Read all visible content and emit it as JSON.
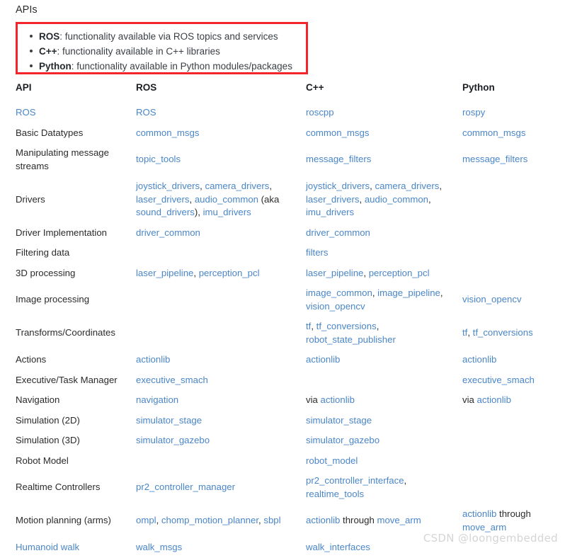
{
  "heading": "APIs",
  "callout": {
    "accent_color": "#f4252a",
    "items": [
      {
        "term": "ROS",
        "rest": ": functionality available via ROS topics and services"
      },
      {
        "term": "C++",
        "rest": ": functionality available in C++ libraries"
      },
      {
        "term": "Python",
        "rest": ": functionality available in Python modules/packages"
      }
    ]
  },
  "table": {
    "link_color": "#4a86c8",
    "columns": [
      "API",
      "ROS",
      "C++",
      "Python"
    ],
    "rows": [
      {
        "api": "ROS",
        "api_link": true,
        "ros": [
          {
            "t": "ROS",
            "link": true
          }
        ],
        "cpp": [
          {
            "t": "roscpp",
            "link": true
          }
        ],
        "py": [
          {
            "t": "rospy",
            "link": true
          }
        ]
      },
      {
        "api": "Basic Datatypes",
        "api_link": false,
        "ros": [
          {
            "t": "common_msgs",
            "link": true
          }
        ],
        "cpp": [
          {
            "t": "common_msgs",
            "link": true
          }
        ],
        "py": [
          {
            "t": "common_msgs",
            "link": true
          }
        ]
      },
      {
        "api": "Manipulating message streams",
        "api_link": false,
        "ros": [
          {
            "t": "topic_tools",
            "link": true
          }
        ],
        "cpp": [
          {
            "t": "message_filters",
            "link": true
          }
        ],
        "py": [
          {
            "t": "message_filters",
            "link": true
          }
        ]
      },
      {
        "api": "Drivers",
        "api_link": false,
        "ros": [
          {
            "t": "joystick_drivers",
            "link": true
          },
          {
            "t": ", ",
            "link": false
          },
          {
            "t": "camera_drivers",
            "link": true
          },
          {
            "t": ", ",
            "link": false
          },
          {
            "t": "laser_drivers",
            "link": true
          },
          {
            "t": ", ",
            "link": false
          },
          {
            "t": "audio_common",
            "link": true
          },
          {
            "t": " (aka ",
            "link": false
          },
          {
            "t": "sound_drivers",
            "link": true
          },
          {
            "t": "), ",
            "link": false
          },
          {
            "t": "imu_drivers",
            "link": true
          }
        ],
        "cpp": [
          {
            "t": "joystick_drivers",
            "link": true
          },
          {
            "t": ", ",
            "link": false
          },
          {
            "t": "camera_drivers",
            "link": true
          },
          {
            "t": ", ",
            "link": false
          },
          {
            "t": "laser_drivers",
            "link": true
          },
          {
            "t": ", ",
            "link": false
          },
          {
            "t": "audio_common",
            "link": true
          },
          {
            "t": ", ",
            "link": false
          },
          {
            "t": "imu_drivers",
            "link": true
          }
        ],
        "py": []
      },
      {
        "api": "Driver Implementation",
        "api_link": false,
        "ros": [
          {
            "t": "driver_common",
            "link": true
          }
        ],
        "cpp": [
          {
            "t": "driver_common",
            "link": true
          }
        ],
        "py": []
      },
      {
        "api": "Filtering data",
        "api_link": false,
        "ros": [],
        "cpp": [
          {
            "t": "filters",
            "link": true
          }
        ],
        "py": []
      },
      {
        "api": "3D processing",
        "api_link": false,
        "ros": [
          {
            "t": "laser_pipeline",
            "link": true
          },
          {
            "t": ", ",
            "link": false
          },
          {
            "t": "perception_pcl",
            "link": true
          }
        ],
        "cpp": [
          {
            "t": "laser_pipeline",
            "link": true
          },
          {
            "t": ", ",
            "link": false
          },
          {
            "t": "perception_pcl",
            "link": true
          }
        ],
        "py": []
      },
      {
        "api": "Image processing",
        "api_link": false,
        "ros": [],
        "cpp": [
          {
            "t": "image_common",
            "link": true
          },
          {
            "t": ", ",
            "link": false
          },
          {
            "t": "image_pipeline",
            "link": true
          },
          {
            "t": ", ",
            "link": false
          },
          {
            "t": "vision_opencv",
            "link": true
          }
        ],
        "py": [
          {
            "t": "vision_opencv",
            "link": true
          }
        ]
      },
      {
        "api": "Transforms/Coordinates",
        "api_link": false,
        "ros": [],
        "cpp": [
          {
            "t": "tf",
            "link": true
          },
          {
            "t": ", ",
            "link": false
          },
          {
            "t": "tf_conversions",
            "link": true
          },
          {
            "t": ", ",
            "link": false
          },
          {
            "t": "robot_state_publisher",
            "link": true
          }
        ],
        "py": [
          {
            "t": "tf",
            "link": true
          },
          {
            "t": ", ",
            "link": false
          },
          {
            "t": "tf_conversions",
            "link": true
          }
        ]
      },
      {
        "api": "Actions",
        "api_link": false,
        "ros": [
          {
            "t": "actionlib",
            "link": true
          }
        ],
        "cpp": [
          {
            "t": "actionlib",
            "link": true
          }
        ],
        "py": [
          {
            "t": "actionlib",
            "link": true
          }
        ]
      },
      {
        "api": "Executive/Task Manager",
        "api_link": false,
        "ros": [
          {
            "t": "executive_smach",
            "link": true
          }
        ],
        "cpp": [],
        "py": [
          {
            "t": "executive_smach",
            "link": true
          }
        ]
      },
      {
        "api": "Navigation",
        "api_link": false,
        "ros": [
          {
            "t": "navigation",
            "link": true
          }
        ],
        "cpp": [
          {
            "t": "via ",
            "link": false
          },
          {
            "t": "actionlib",
            "link": true
          }
        ],
        "py": [
          {
            "t": "via ",
            "link": false
          },
          {
            "t": "actionlib",
            "link": true
          }
        ]
      },
      {
        "api": "Simulation (2D)",
        "api_link": false,
        "ros": [
          {
            "t": "simulator_stage",
            "link": true
          }
        ],
        "cpp": [
          {
            "t": "simulator_stage",
            "link": true
          }
        ],
        "py": []
      },
      {
        "api": "Simulation (3D)",
        "api_link": false,
        "ros": [
          {
            "t": "simulator_gazebo",
            "link": true
          }
        ],
        "cpp": [
          {
            "t": "simulator_gazebo",
            "link": true
          }
        ],
        "py": []
      },
      {
        "api": "Robot Model",
        "api_link": false,
        "ros": [],
        "cpp": [
          {
            "t": "robot_model",
            "link": true
          }
        ],
        "py": []
      },
      {
        "api": "Realtime Controllers",
        "api_link": false,
        "ros": [
          {
            "t": "pr2_controller_manager",
            "link": true
          }
        ],
        "cpp": [
          {
            "t": "pr2_controller_interface",
            "link": true
          },
          {
            "t": ", ",
            "link": false
          },
          {
            "t": "realtime_tools",
            "link": true
          }
        ],
        "py": []
      },
      {
        "api": "Motion planning (arms)",
        "api_link": false,
        "ros": [
          {
            "t": "ompl",
            "link": true
          },
          {
            "t": ", ",
            "link": false
          },
          {
            "t": "chomp_motion_planner",
            "link": true
          },
          {
            "t": ", ",
            "link": false
          },
          {
            "t": "sbpl",
            "link": true
          }
        ],
        "cpp": [
          {
            "t": "actionlib",
            "link": true
          },
          {
            "t": " through ",
            "link": false
          },
          {
            "t": "move_arm",
            "link": true
          }
        ],
        "py": [
          {
            "t": "actionlib",
            "link": true
          },
          {
            "t": " through ",
            "link": false
          },
          {
            "t": "move_arm",
            "link": true
          }
        ]
      },
      {
        "api": "Humanoid walk",
        "api_link": true,
        "ros": [
          {
            "t": "walk_msgs",
            "link": true
          }
        ],
        "cpp": [
          {
            "t": "walk_interfaces",
            "link": true
          }
        ],
        "py": []
      }
    ]
  },
  "watermark": "CSDN @loongembedded"
}
